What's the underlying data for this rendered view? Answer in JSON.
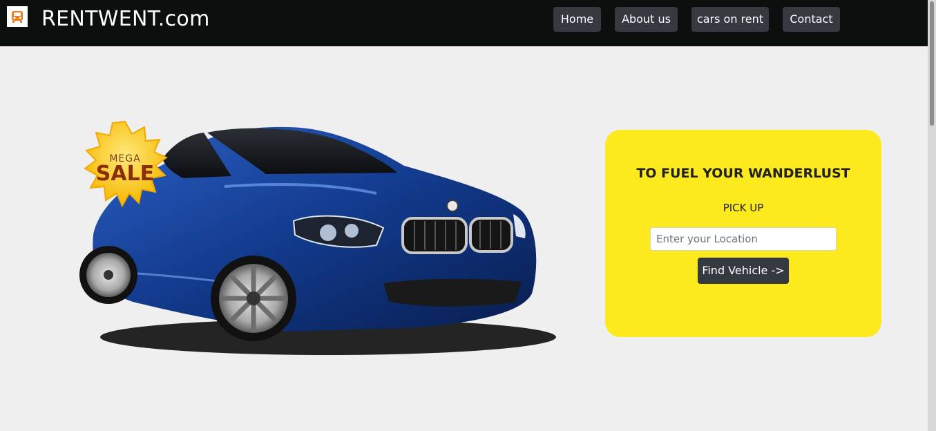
{
  "header": {
    "brand": "RENTWENT.com",
    "logo_icon": "car-icon"
  },
  "nav": {
    "items": [
      {
        "label": "Home"
      },
      {
        "label": "About us"
      },
      {
        "label": "cars on rent"
      },
      {
        "label": "Contact"
      }
    ]
  },
  "hero": {
    "badge_top": "MEGA",
    "badge_main": "SALE"
  },
  "booking": {
    "title": "TO FUEL YOUR WANDERLUST",
    "subtitle": "PICK UP",
    "location_placeholder": "Enter your Location",
    "location_value": "",
    "button_label": "Find Vehicle ->"
  },
  "colors": {
    "navbar": "#0b0f0e",
    "page_bg": "#efefef",
    "card": "#fcea1f",
    "button": "#343a40",
    "logo_accent": "#f07d1a",
    "car_body": "#123a8c"
  }
}
